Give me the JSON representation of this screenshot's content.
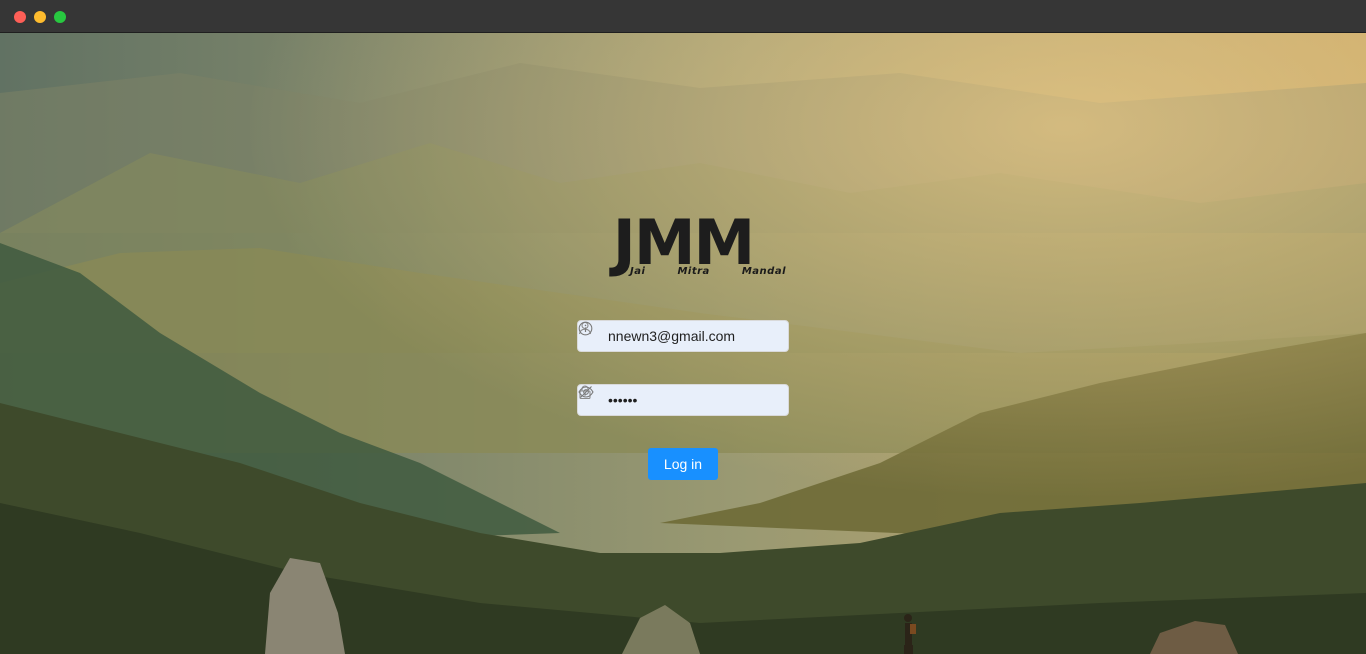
{
  "brand": {
    "logo_text": "JMM",
    "logo_words": [
      "Jai",
      "Mitra",
      "Mandal"
    ]
  },
  "form": {
    "email_value": "nnewn3@gmail.com",
    "password_value": "••••••",
    "login_label": "Log in"
  },
  "colors": {
    "primary": "#1890ff",
    "input_bg": "#e8effa",
    "logo": "#1d1d1d"
  },
  "icons": {
    "email_prefix": "user-icon",
    "email_suffix": "info-circle-icon",
    "password_prefix": "lock-icon",
    "password_suffix": "eye-invisible-icon"
  }
}
